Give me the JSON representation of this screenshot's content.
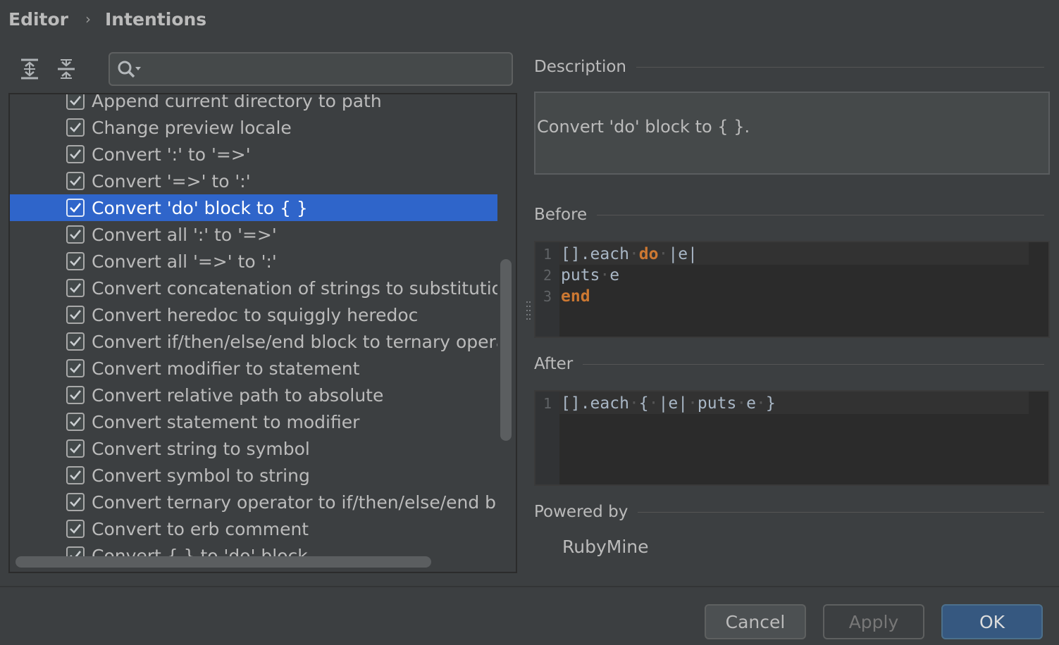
{
  "breadcrumb": {
    "parent": "Editor",
    "separator": "›",
    "current": "Intentions"
  },
  "toolbar": {
    "expand_icon": "expand-all-icon",
    "collapse_icon": "collapse-all-icon"
  },
  "search": {
    "value": "",
    "placeholder": "",
    "icon": "search-icon"
  },
  "intentions": {
    "items": [
      {
        "label": "Append current directory to path",
        "checked": true
      },
      {
        "label": "Change preview locale",
        "checked": true
      },
      {
        "label": "Convert ':' to '=>'",
        "checked": true
      },
      {
        "label": "Convert '=>' to ':'",
        "checked": true
      },
      {
        "label": "Convert 'do' block to { }",
        "checked": true,
        "selected": true
      },
      {
        "label": "Convert all ':' to '=>'",
        "checked": true
      },
      {
        "label": "Convert all '=>' to ':'",
        "checked": true
      },
      {
        "label": "Convert concatenation of strings to substitutio",
        "checked": true
      },
      {
        "label": "Convert heredoc to squiggly heredoc",
        "checked": true
      },
      {
        "label": "Convert if/then/else/end block to ternary opera",
        "checked": true
      },
      {
        "label": "Convert modifier to statement",
        "checked": true
      },
      {
        "label": "Convert relative path to absolute",
        "checked": true
      },
      {
        "label": "Convert statement to modifier",
        "checked": true
      },
      {
        "label": "Convert string to symbol",
        "checked": true
      },
      {
        "label": "Convert symbol to string",
        "checked": true
      },
      {
        "label": "Convert ternary operator to if/then/else/end blo",
        "checked": true
      },
      {
        "label": "Convert to erb comment",
        "checked": true
      },
      {
        "label": "Convert { } to 'do' block",
        "checked": true
      }
    ]
  },
  "description": {
    "title": "Description",
    "text": "Convert 'do' block to { }."
  },
  "before": {
    "title": "Before",
    "lines": [
      {
        "num": "1",
        "parts": [
          [
            "[].each",
            ""
          ],
          [
            "·",
            "dot"
          ],
          [
            "do",
            "kw"
          ],
          [
            "·",
            "dot"
          ],
          [
            "|e|",
            ""
          ]
        ]
      },
      {
        "num": "2",
        "parts": [
          [
            "puts",
            ""
          ],
          [
            "·",
            "dot"
          ],
          [
            "e",
            ""
          ]
        ]
      },
      {
        "num": "3",
        "parts": [
          [
            "end",
            "kw"
          ]
        ]
      }
    ]
  },
  "after": {
    "title": "After",
    "lines": [
      {
        "num": "1",
        "parts": [
          [
            "[].each",
            ""
          ],
          [
            "·",
            "dot"
          ],
          [
            "{",
            ""
          ],
          [
            "·",
            "dot"
          ],
          [
            "|e|",
            ""
          ],
          [
            "·",
            "dot"
          ],
          [
            "puts",
            ""
          ],
          [
            "·",
            "dot"
          ],
          [
            "e",
            ""
          ],
          [
            "·",
            "dot"
          ],
          [
            "}",
            ""
          ]
        ]
      }
    ]
  },
  "powered": {
    "title": "Powered by",
    "name": "RubyMine"
  },
  "buttons": {
    "cancel": "Cancel",
    "apply": "Apply",
    "ok": "OK"
  },
  "colors": {
    "selection": "#2f65ca",
    "keyword": "#cc7832",
    "ok_button": "#365880"
  }
}
